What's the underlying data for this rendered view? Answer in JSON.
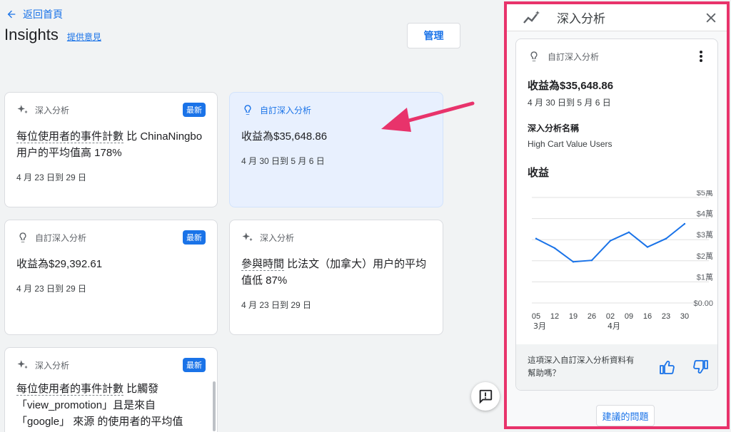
{
  "nav": {
    "back_label": "返回首頁",
    "title": "Insights",
    "feedback_label": "提供意見",
    "manage_label": "管理"
  },
  "cards": [
    {
      "type": "深入分析",
      "badge": "最新",
      "metric": "每位使用者的事件計數",
      "rest": " 比 ChinaNingbo 用户的平均值高 178%",
      "date": "4 月 23 日到 29 日"
    },
    {
      "type": "自訂深入分析",
      "badge": "",
      "text": "收益為$35,648.86",
      "date": "4 月 30 日到 5 月 6 日"
    },
    {
      "type": "自訂深入分析",
      "badge": "最新",
      "text": "收益為$29,392.61",
      "date": "4 月 23 日到 29 日"
    },
    {
      "type": "深入分析",
      "badge": "",
      "metric": "參與時間",
      "rest": " 比法文（加拿大）用户的平均值低 87%",
      "date": "4 月 23 日到 29 日"
    },
    {
      "type": "深入分析",
      "badge": "最新",
      "metric": "每位使用者的事件計數",
      "rest": " 比觸發「view_promotion」且是來自「google」 來源 的使用者的平均值",
      "date": ""
    }
  ],
  "panel": {
    "title": "深入分析",
    "detail": {
      "type": "自訂深入分析",
      "value": "收益為$35,648.86",
      "date": "4 月 30 日到 5 月 6 日",
      "name_label": "深入分析名稱",
      "name": "High Cart Value Users",
      "chart_title": "收益"
    },
    "helpful_question": "這項深入自訂深入分析資料有幫助嗎？",
    "suggest_label": "建議的問題"
  },
  "chart_data": {
    "type": "line",
    "x": [
      "05",
      "12",
      "19",
      "26",
      "02",
      "09",
      "16",
      "23",
      "30"
    ],
    "x_month_labels": [
      {
        "at": "05",
        "label": "3月"
      },
      {
        "at": "02",
        "label": "4月"
      }
    ],
    "y_ticks": [
      "$0.00",
      "$1萬",
      "$2萬",
      "$3萬",
      "$4萬",
      "$5萬"
    ],
    "ylim": [
      0,
      50000
    ],
    "series": [
      {
        "values": [
          30500,
          26000,
          19500,
          20200,
          29500,
          33500,
          26500,
          30500,
          37500
        ]
      }
    ],
    "colors": {
      "line": "#1a73e8",
      "grid": "#e0e0e0"
    },
    "grid": true
  },
  "colors": {
    "accent": "#1a73e8",
    "highlight": "#e8336b",
    "selected_card": "#e8f0fe"
  }
}
